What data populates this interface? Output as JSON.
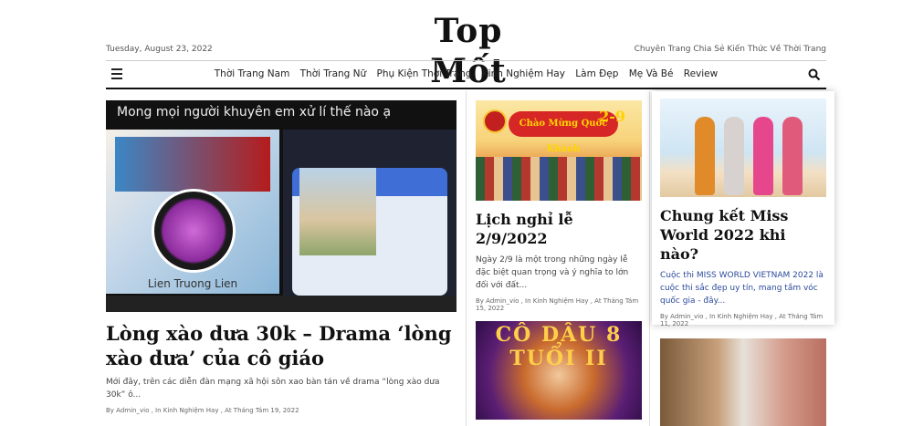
{
  "header": {
    "logo": "Top Mốt",
    "date": "Tuesday, August 23, 2022",
    "tagline": "Chuyên Trang Chia Sẻ Kiến Thức Về Thời Trang"
  },
  "nav": {
    "items": [
      {
        "label": "Thời Trang Nam"
      },
      {
        "label": "Thời Trang Nữ"
      },
      {
        "label": "Phụ Kiện Thời Trang"
      },
      {
        "label": "Kinh Nghiệm Hay"
      },
      {
        "label": "Làm Đẹp"
      },
      {
        "label": "Mẹ Và Bé"
      },
      {
        "label": "Review"
      }
    ],
    "menu_icon": "hamburger-menu-icon",
    "search_icon": "search-icon"
  },
  "featured": {
    "image_caption": "Mong mọi người khuyên em xử lí thế nào ạ",
    "profile_name": "Lien Truong Lien",
    "title": "Lòng xào dưa 30k – Drama ‘lòng xào dưa’ của cô giáo",
    "excerpt": "Mới đây, trên các diễn đàn mạng xã hội sôn xao bàn tán về drama “lòng xào dưa 30k” ô...",
    "meta": "By Admin_vio , In Kinh Nghiệm Hay , At Tháng Tám 19, 2022"
  },
  "middle": {
    "post1": {
      "image_banner": "Chào Mừng Quốc Khánh",
      "image_number": "2-9",
      "title": "Lịch nghỉ lễ 2/9/2022",
      "excerpt": "Ngày 2/9 là một trong những ngày lễ đặc biệt quan trọng và ý nghĩa to lớn đối với đất...",
      "meta": "By Admin_vio , In Kinh Nghiệm Hay , At Tháng Tám 15, 2022"
    },
    "post2": {
      "image_title": "CÔ DÂU 8 TUỔI II"
    }
  },
  "right": {
    "post1": {
      "title": "Chung kết Miss World 2022 khi nào?",
      "excerpt": "Cuộc thi MISS WORLD VIETNAM 2022 là cuộc thi sắc đẹp uy tín, mang tầm vóc quốc gia - đây...",
      "meta": "By Admin_vio , In Kinh Nghiệm Hay , At Tháng Tám 11, 2022"
    }
  }
}
